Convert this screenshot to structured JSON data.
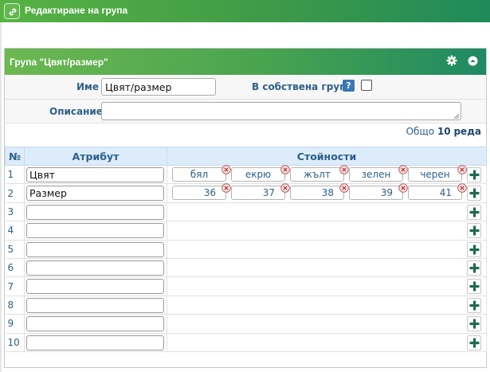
{
  "header": {
    "title": "Редактиране на група",
    "icon": "link-icon"
  },
  "panel": {
    "title": "Група \"Цвят/размер\"",
    "icons": [
      "gear-icon",
      "collapse-icon"
    ]
  },
  "form": {
    "name_label": "Име",
    "name_value": "Цвят/размер",
    "own_group_label": "В собствена група",
    "help_label": "?",
    "description_label": "Описание",
    "description_value": ""
  },
  "total": {
    "label": "Общо",
    "count": "10",
    "unit": "реда"
  },
  "table": {
    "col_num": "№",
    "col_attr": "Атрибут",
    "col_values": "Стойности",
    "rows": [
      {
        "n": "1",
        "attr": "Цвят",
        "values": [
          "бял",
          "екрю",
          "жълт",
          "зелен",
          "черен"
        ]
      },
      {
        "n": "2",
        "attr": "Размер",
        "values": [
          "36",
          "37",
          "38",
          "39",
          "41"
        ]
      },
      {
        "n": "3",
        "attr": "",
        "values": []
      },
      {
        "n": "4",
        "attr": "",
        "values": []
      },
      {
        "n": "5",
        "attr": "",
        "values": []
      },
      {
        "n": "6",
        "attr": "",
        "values": []
      },
      {
        "n": "7",
        "attr": "",
        "values": []
      },
      {
        "n": "8",
        "attr": "",
        "values": []
      },
      {
        "n": "9",
        "attr": "",
        "values": []
      },
      {
        "n": "10",
        "attr": "",
        "values": []
      }
    ]
  },
  "colors": {
    "header_green": "#3f9a48",
    "label_blue": "#2d5f8a",
    "table_head_bg": "#dcecfb",
    "plus_green": "#1f6b4f"
  }
}
